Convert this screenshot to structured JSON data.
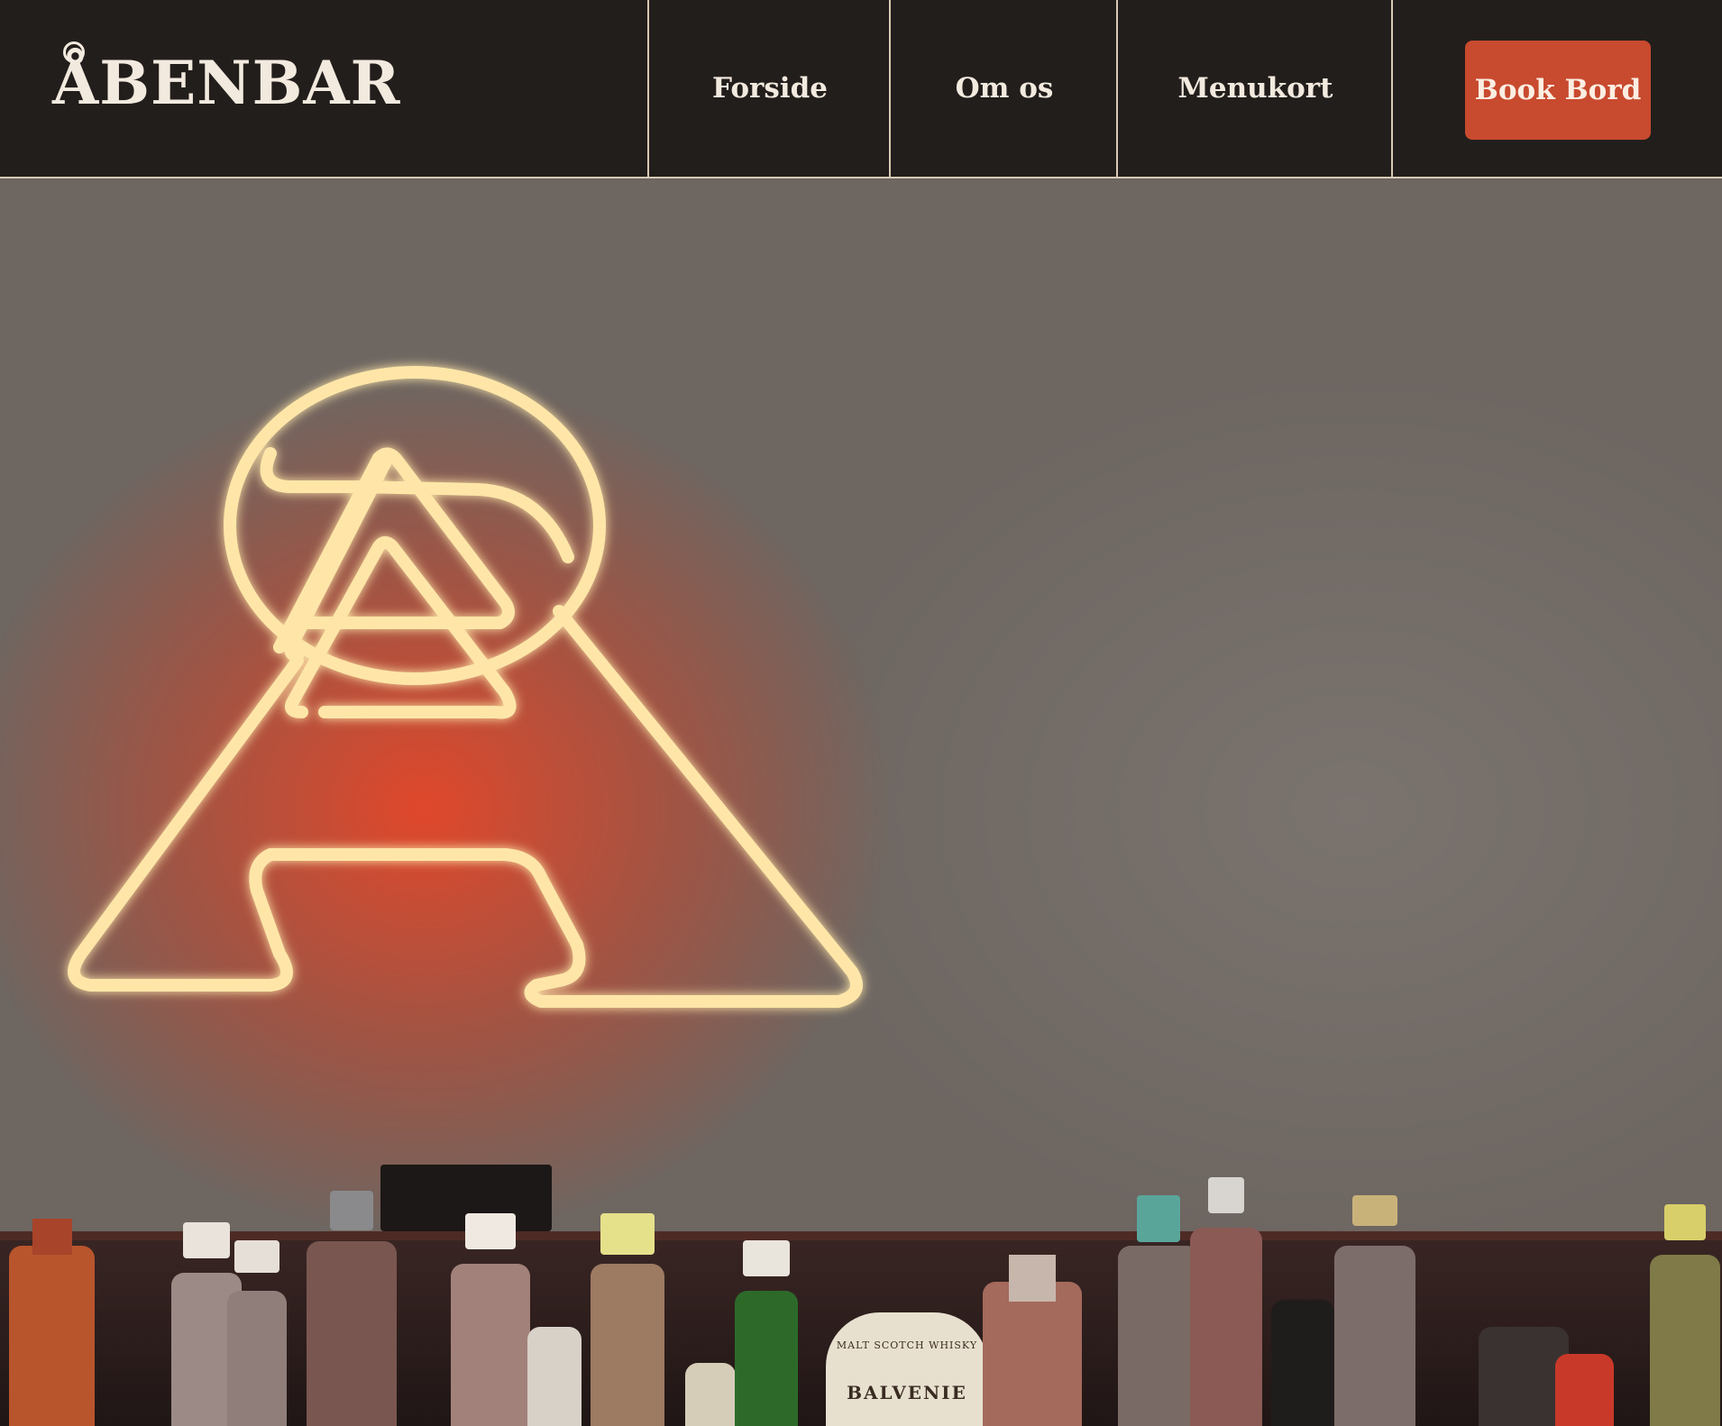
{
  "brand": {
    "name": "ÅBENBAR"
  },
  "nav": {
    "items": [
      {
        "label": "Forside"
      },
      {
        "label": "Om os"
      },
      {
        "label": "Menukort"
      }
    ],
    "cta_label": "Book Bord"
  },
  "hero": {
    "image": "neon-a-sign-over-bar-bottles",
    "bottle_label_text": "MALT SCOTCH WHISKY",
    "bottle_brand_text": "BALVENIE"
  },
  "colors": {
    "header_bg": "#221e1c",
    "divider": "#d9c9b4",
    "accent": "#c84a2f",
    "text_light": "#f3eadf"
  }
}
